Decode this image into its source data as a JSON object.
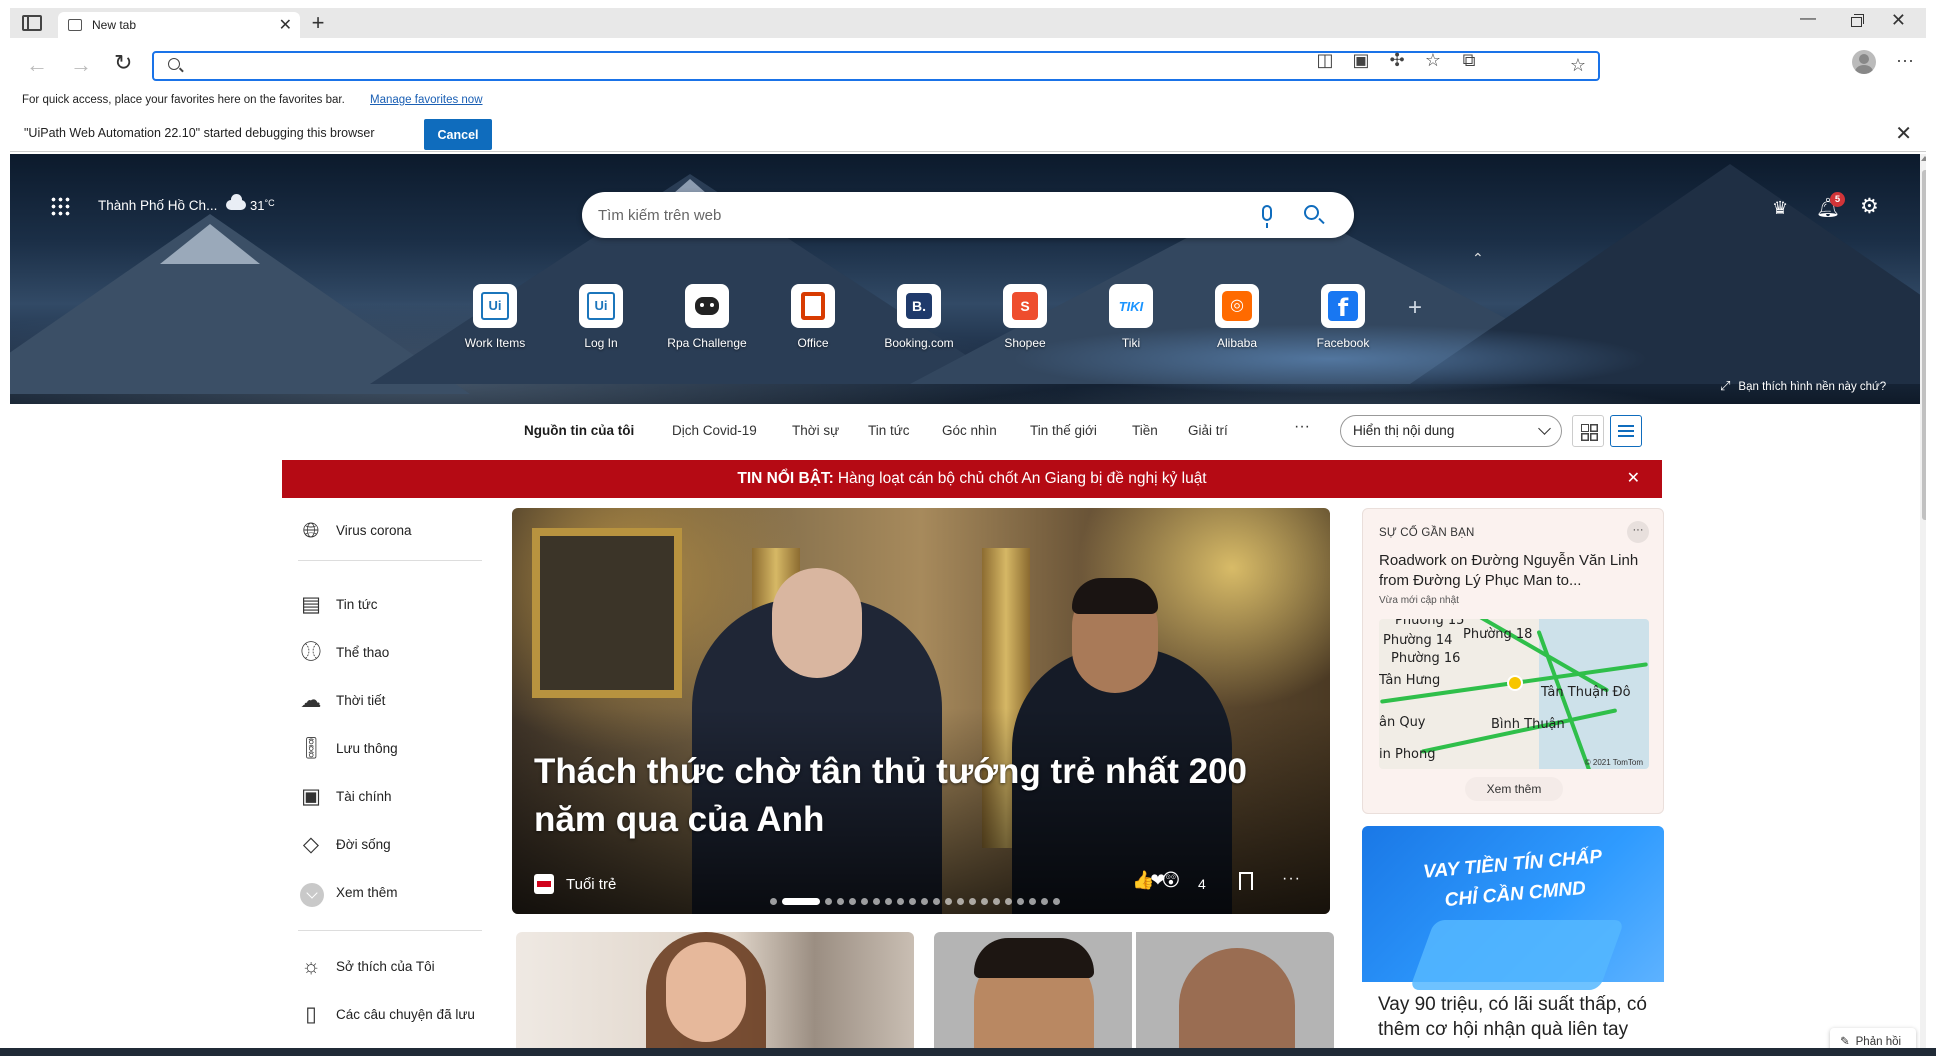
{
  "browser": {
    "tab_title": "New tab",
    "address_value": "",
    "favorites_bar_text": "For quick access, place your favorites here on the favorites bar.",
    "favorites_bar_link": "Manage favorites now",
    "debug_message": "\"UiPath Web Automation 22.10\" started debugging this browser",
    "debug_cancel": "Cancel"
  },
  "hero": {
    "location": "Thành Phố Hồ Ch...",
    "temperature": "31",
    "temperature_unit": "°C",
    "search_placeholder": "Tìm kiếm trên web",
    "notification_count": "5",
    "wallpaper_prompt": "Bạn thích hình nền này chứ?"
  },
  "quick_links": [
    {
      "label": "Work Items",
      "icon": "uipath-icon"
    },
    {
      "label": "Log In",
      "icon": "uipath-icon"
    },
    {
      "label": "Rpa Challenge",
      "icon": "robot-icon"
    },
    {
      "label": "Office",
      "icon": "office-icon"
    },
    {
      "label": "Booking.com",
      "icon": "booking-icon"
    },
    {
      "label": "Shopee",
      "icon": "shopee-icon"
    },
    {
      "label": "Tiki",
      "icon": "tiki-icon"
    },
    {
      "label": "Alibaba",
      "icon": "alibaba-icon"
    },
    {
      "label": "Facebook",
      "icon": "facebook-icon"
    }
  ],
  "content_nav": {
    "items": [
      "Nguồn tin của tôi",
      "Dịch Covid-19",
      "Thời sự",
      "Tin tức",
      "Góc nhìn",
      "Tin thế giới",
      "Tiền",
      "Giải trí"
    ],
    "more": "···",
    "display_select": "Hiển thị nội dung"
  },
  "breaking": {
    "label": "TIN NỔI BẬT:",
    "text": "Hàng loạt cán bộ chủ chốt An Giang bị đề nghị kỷ luật"
  },
  "sidebar": {
    "items": [
      {
        "label": "Virus corona",
        "icon": "globe-icon"
      },
      {
        "label": "Tin tức",
        "icon": "news-icon"
      },
      {
        "label": "Thể thao",
        "icon": "sports-icon"
      },
      {
        "label": "Thời tiết",
        "icon": "weather-icon"
      },
      {
        "label": "Lưu thông",
        "icon": "traffic-icon"
      },
      {
        "label": "Tài chính",
        "icon": "finance-icon"
      },
      {
        "label": "Đời sống",
        "icon": "lifestyle-icon"
      },
      {
        "label": "Xem thêm",
        "icon": "chevron-down-icon"
      },
      {
        "label": "Sở thích của Tôi",
        "icon": "interests-icon"
      },
      {
        "label": "Các câu chuyện đã lưu",
        "icon": "saved-icon"
      }
    ]
  },
  "hero_story": {
    "title": "Thách thức chờ tân thủ tướng trẻ nhất 200 năm qua của Anh",
    "source": "Tuổi trẻ",
    "reaction_count": "4",
    "slide_count": 22,
    "active_slide": 1
  },
  "nearby": {
    "label": "SỰ CỐ GẦN BẠN",
    "title": "Roadwork on Đường Nguyễn Văn Linh from Đường Lý Phục Man to...",
    "updated": "Vừa mới cập nhật",
    "map_labels": [
      "Phường 14",
      "Phường 18",
      "Phường 16",
      "Tân Hưng",
      "Tân Thuận Đô",
      "ân Quy",
      "Bình Thuận",
      "in Phong",
      "Phường 15"
    ],
    "map_copyright": "© 2021 TomTom",
    "see_more": "Xem thêm"
  },
  "ad": {
    "headline_line1": "VAY TIỀN TÍN CHẤP",
    "headline_line2": "CHỈ CẦN CMND",
    "title": "Vay 90 triệu, có lãi suất thấp, có thêm cơ hội nhận quà liên tay"
  },
  "feedback": "Phản hồi",
  "colors": {
    "accent": "#0f6cbd",
    "breaking_bg": "#b50a14",
    "notification_badge": "#d13438"
  }
}
